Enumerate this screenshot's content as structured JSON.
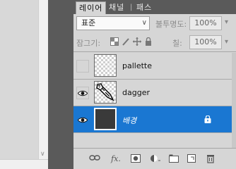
{
  "tabs": [
    {
      "label": "레이어",
      "active": true
    },
    {
      "label": "채널",
      "active": false
    },
    {
      "label": "패스",
      "active": false
    }
  ],
  "blend": {
    "value": "표준",
    "opacity_label": "불투명도:",
    "opacity_value": "100%"
  },
  "lock": {
    "label": "잠그기:",
    "fill_label": "칠:",
    "fill_value": "100%",
    "icons": [
      "lock-transparency-icon",
      "lock-paint-icon",
      "lock-move-icon",
      "lock-all-icon"
    ]
  },
  "layers": [
    {
      "name": "pallette",
      "visible": false,
      "thumb": "transparent",
      "selected": false
    },
    {
      "name": "dagger",
      "visible": true,
      "thumb": "dagger",
      "selected": false
    },
    {
      "name": "배경",
      "visible": true,
      "thumb": "dark",
      "selected": true,
      "locked": true
    }
  ],
  "footer_icons": [
    "link-layers-icon",
    "fx-icon",
    "add-mask-icon",
    "adjustment-layer-icon",
    "new-group-icon",
    "new-layer-icon",
    "delete-layer-icon"
  ],
  "colors": {
    "selected": "#1a77d2",
    "panel": "#d6d6d6",
    "tabbar": "#5a5a5a"
  }
}
